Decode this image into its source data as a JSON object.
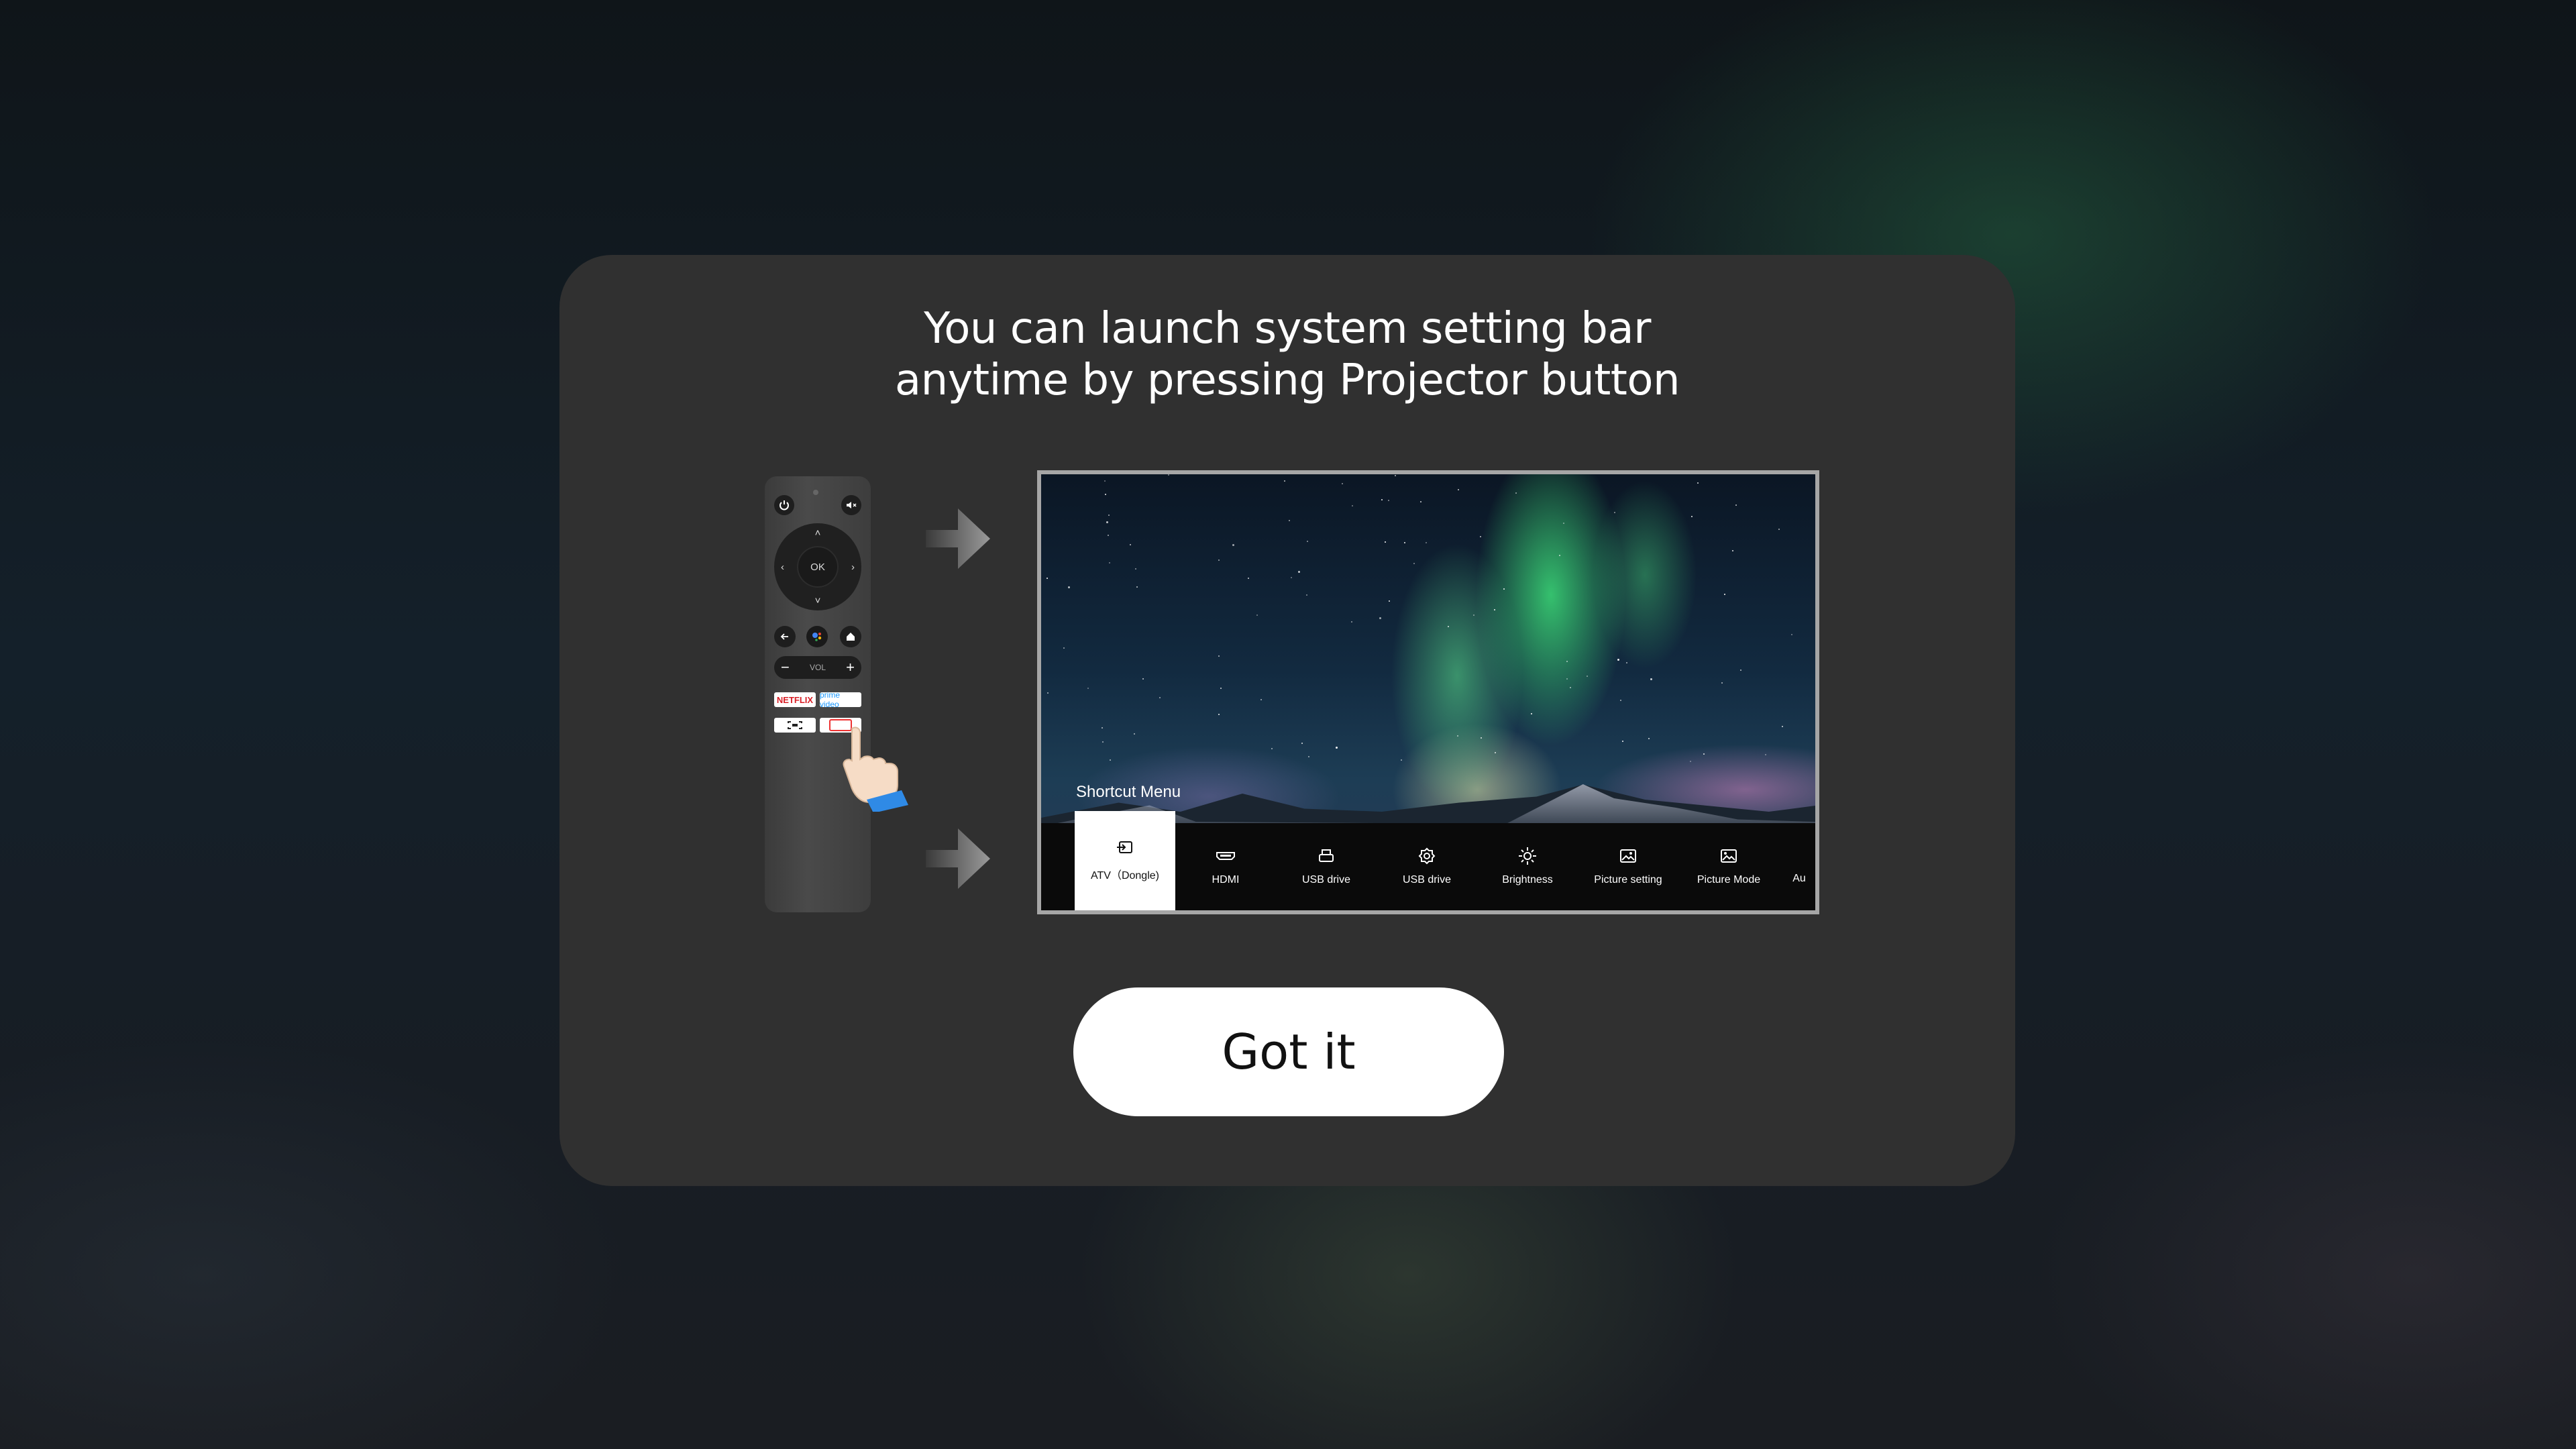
{
  "dialog": {
    "title_line1": "You can launch system setting bar",
    "title_line2": "anytime by pressing Projector button"
  },
  "remote": {
    "ok_label": "OK",
    "vol_label": "VOL",
    "netflix_label": "NETFLIX",
    "prime_label": "prime video",
    "icons": [
      "power-icon",
      "mute-icon",
      "dpad",
      "back-icon",
      "assistant-icon",
      "home-icon",
      "screen-icon",
      "projector-icon"
    ]
  },
  "preview": {
    "menu_title": "Shortcut Menu",
    "items": [
      {
        "label": "ATV（Dongle)",
        "icon": "input-icon",
        "active": true
      },
      {
        "label": "HDMI",
        "icon": "hdmi-icon"
      },
      {
        "label": "USB drive",
        "icon": "usb-icon"
      },
      {
        "label": "USB drive",
        "icon": "settings-icon"
      },
      {
        "label": "Brightness",
        "icon": "brightness-icon"
      },
      {
        "label": "Picture setting",
        "icon": "image-icon"
      },
      {
        "label": "Picture Mode",
        "icon": "image-mode-icon"
      },
      {
        "label": "Au",
        "icon": "audio-icon"
      }
    ]
  },
  "button": {
    "label": "Got it"
  }
}
